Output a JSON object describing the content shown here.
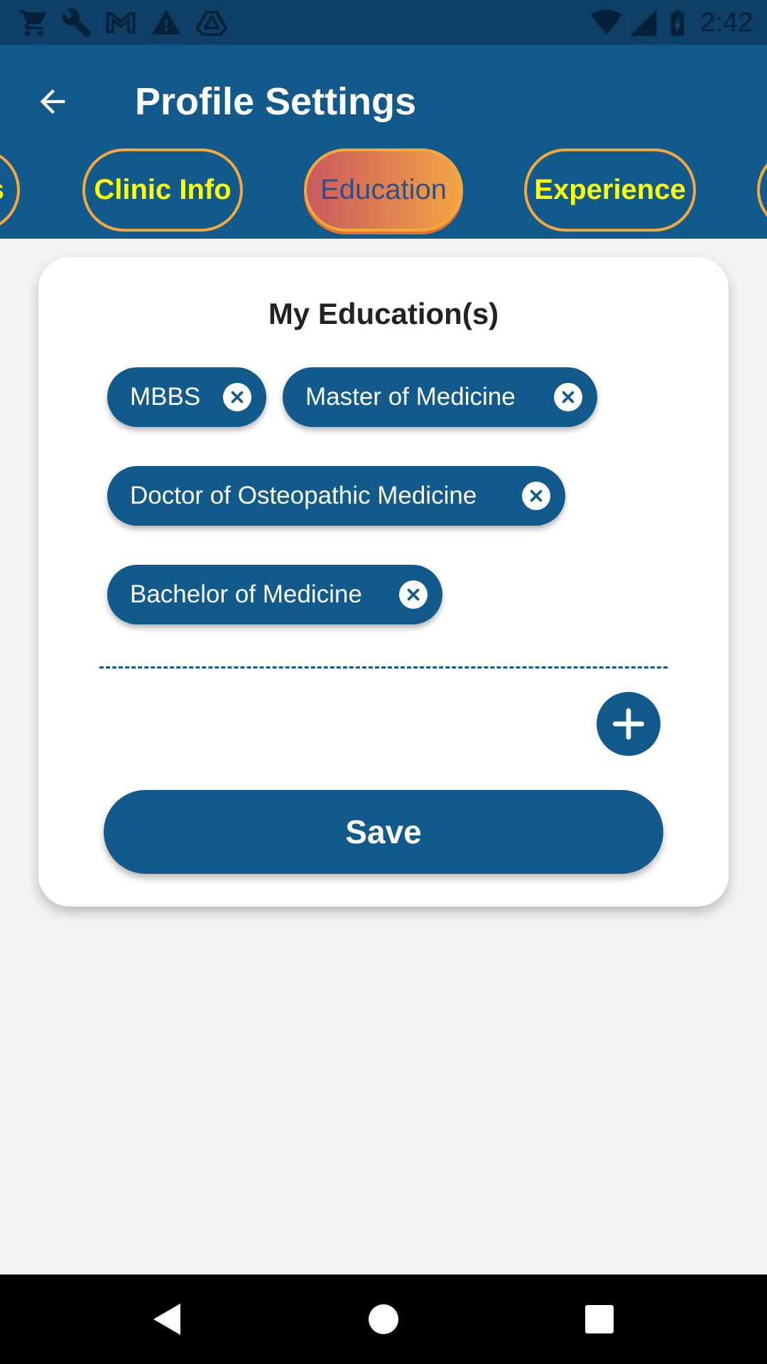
{
  "status_bar": {
    "time": "2:42",
    "left_icons": [
      "cart-icon",
      "wrench-icon",
      "gmail-icon",
      "warning-icon",
      "drive-icon"
    ],
    "right_icons": [
      "wifi-icon",
      "signal-icon",
      "battery-charging-icon"
    ]
  },
  "app_bar": {
    "title": "Profile Settings",
    "back_icon": "arrow-left-icon",
    "background": "#135a8c"
  },
  "tabs": [
    {
      "label": "s",
      "active": false
    },
    {
      "label": "Clinic Info",
      "active": false
    },
    {
      "label": "Education",
      "active": true
    },
    {
      "label": "Experience",
      "active": false
    },
    {
      "label": "",
      "active": false
    }
  ],
  "card": {
    "title": "My Education(s)",
    "chips": [
      {
        "label": "MBBS"
      },
      {
        "label": "Master of Medicine"
      },
      {
        "label": "Doctor of Osteopathic Medicine"
      },
      {
        "label": "Bachelor of Medicine"
      }
    ],
    "add_icon": "plus-circle-icon",
    "save_label": "Save"
  },
  "colors": {
    "primary": "#135a8c",
    "tab_border": "#f5a93a",
    "tab_text": "#ffff00",
    "active_tab_gradient": [
      "#c95a5f",
      "#f4a444"
    ]
  },
  "nav_bar": {
    "buttons": [
      "back-triangle-icon",
      "home-circle-icon",
      "recents-square-icon"
    ]
  }
}
